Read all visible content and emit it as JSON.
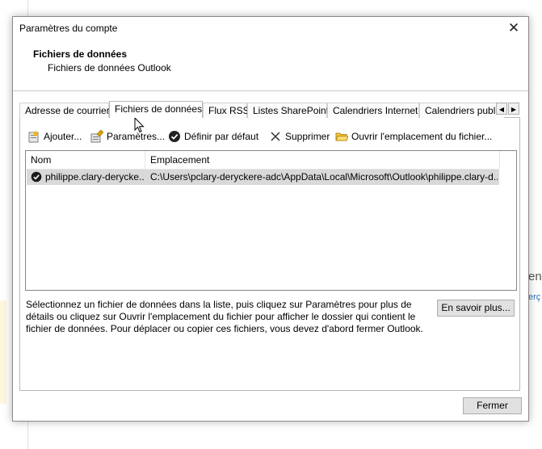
{
  "dialog": {
    "title": "Paramètres du compte",
    "close_symbol": "✕",
    "header_title": "Fichiers de données",
    "header_subtitle": "Fichiers de données Outlook"
  },
  "tabs": [
    {
      "label": "Adresse de courrier",
      "active": false
    },
    {
      "label": "Fichiers de données",
      "active": true
    },
    {
      "label": "Flux RSS",
      "active": false
    },
    {
      "label": "Listes SharePoint",
      "active": false
    },
    {
      "label": "Calendriers Internet",
      "active": false
    },
    {
      "label": "Calendriers publi",
      "active": false
    }
  ],
  "tab_scroll": {
    "left": "◀",
    "right": "▶"
  },
  "toolbar": {
    "add": "Ajouter...",
    "settings": "Paramètres...",
    "set_default": "Définir par défaut",
    "remove": "Supprimer",
    "open_location": "Ouvrir l'emplacement du fichier..."
  },
  "list": {
    "columns": [
      "Nom",
      "Emplacement"
    ],
    "rows": [
      {
        "name": "philippe.clary-derycke...",
        "location": "C:\\Users\\pclary-deryckere-adc\\AppData\\Local\\Microsoft\\Outlook\\philippe.clary-d...",
        "default": true
      }
    ]
  },
  "help_text": "Sélectionnez un fichier de données dans la liste, puis cliquez sur Paramètres pour plus de détails ou cliquez sur Ouvrir l'emplacement du fichier pour afficher le dossier qui contient le fichier de données. Pour déplacer ou copier ces fichiers, vous devez d'abord fermer Outlook.",
  "learn_more_button": "En savoir plus...",
  "close_button": "Fermer",
  "background": {
    "fragment1": "en",
    "fragment2": "erç"
  },
  "colors": {
    "selection": "#d9d9d9",
    "button_face": "#e1e1e1",
    "link": "#2b6cb8"
  }
}
